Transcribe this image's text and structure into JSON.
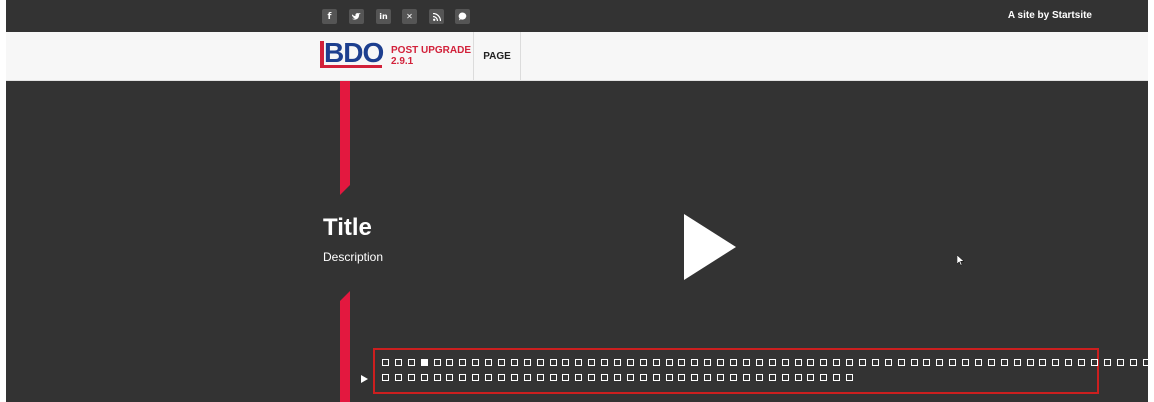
{
  "topbar": {
    "social_icons": [
      {
        "name": "facebook-icon",
        "glyph": "f"
      },
      {
        "name": "twitter-icon",
        "glyph": "y"
      },
      {
        "name": "linkedin-icon",
        "glyph": "in"
      },
      {
        "name": "xing-icon",
        "glyph": "x"
      },
      {
        "name": "rss-icon",
        "glyph": "r"
      },
      {
        "name": "chat-icon",
        "glyph": "●"
      }
    ],
    "credit": "A site by Startsite"
  },
  "header": {
    "logo_text": "BDO",
    "logo_sub_line1": "POST UPGRADE",
    "logo_sub_line2": "2.9.1",
    "nav_item": "PAGE"
  },
  "hero": {
    "title": "Title",
    "description": "Description"
  },
  "slider": {
    "row1_count": 63,
    "row2_count": 37,
    "active_index": 3
  },
  "colors": {
    "dark_bg": "#333333",
    "accent_red": "#d2213a",
    "logo_blue": "#1d3f8f",
    "highlight_border": "#cc1f1f"
  }
}
